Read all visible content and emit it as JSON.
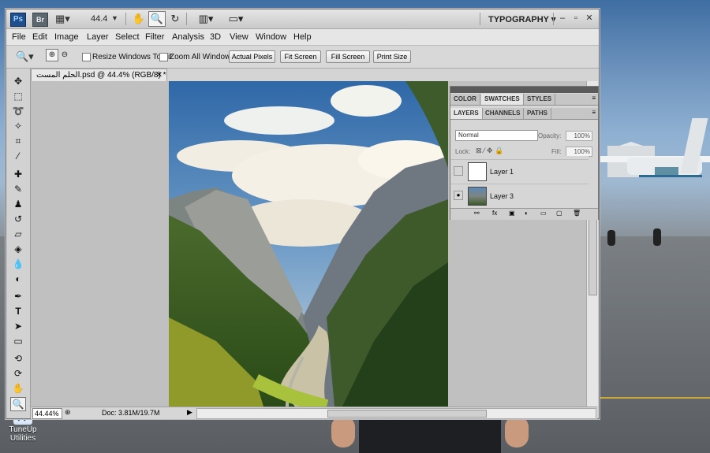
{
  "app": {
    "logo": "Ps",
    "bridge": "Br",
    "zoom_value": "44.4",
    "workspace": "TYPOGRAPHY"
  },
  "menu": [
    "File",
    "Edit",
    "Image",
    "Layer",
    "Select",
    "Filter",
    "Analysis",
    "3D",
    "View",
    "Window",
    "Help"
  ],
  "options": {
    "resize_windows": "Resize Windows To Fit",
    "zoom_all": "Zoom All Windows",
    "actual_pixels": "Actual Pixels",
    "fit_screen": "Fit Screen",
    "fill_screen": "Fill Screen",
    "print_size": "Print Size"
  },
  "document": {
    "tab_title": "الحلم المست.psd @ 44.4% (RGB/8) *",
    "status_zoom": "44.44%",
    "doc_info": "Doc: 3.81M/19.7M"
  },
  "panels": {
    "tabs_top": [
      "COLOR",
      "SWATCHES",
      "STYLES"
    ],
    "tabs_layers": [
      "LAYERS",
      "CHANNELS",
      "PATHS"
    ],
    "blend_mode": "Normal",
    "opacity_label": "Opacity:",
    "opacity": "100%",
    "lock_label": "Lock:",
    "fill_label": "Fill:",
    "fill": "100%",
    "layers": [
      {
        "name": "Layer 1",
        "visible": false
      },
      {
        "name": "Layer 3",
        "visible": true
      }
    ]
  },
  "desktop": {
    "icon_label_1": "TuneUp",
    "icon_label_2": "Utilities"
  }
}
